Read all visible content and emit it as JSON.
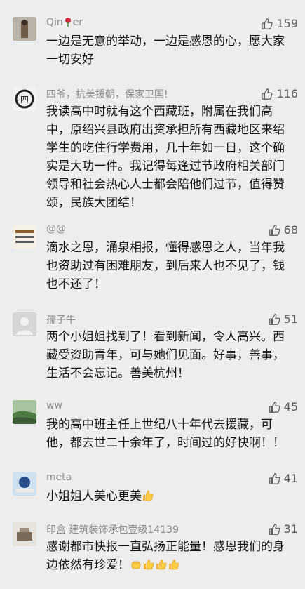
{
  "colors": {
    "background": "#ededed",
    "name": "#8a8a8a",
    "text": "#111111",
    "like": "#5a5a5a"
  },
  "comments": [
    {
      "name_a": "Qin",
      "name_b": "er",
      "name_emoji": "rose-icon",
      "likes": "159",
      "lines": [
        "一边是无意的举动，一边是感恩的心，愿大家",
        "一切安好"
      ]
    },
    {
      "name": "四爷，抗美援朝，保家卫国!",
      "likes": "116",
      "lines": [
        "我读高中时就有这个西藏班，附属在我们高",
        "中，原绍兴县政府出资承担所有西藏地区来绍",
        "学生的吃住行学费用，几十年如一日，这个确",
        "实是大功一件。我记得每逢过节政府相关部门",
        "领导和社会热心人士都会陪他们过节，值得赞",
        "颂，民族大团结！"
      ]
    },
    {
      "name": "@@",
      "likes": "68",
      "lines": [
        "滴水之恩，涌泉相报，懂得感恩之人，当年我",
        "也资助过有困难朋友，到后来人也不见了，钱",
        "也不还了！"
      ]
    },
    {
      "name": "孺子牛",
      "likes": "51",
      "lines": [
        "两个小姐姐找到了！看到新闻，令人高兴。西",
        "藏受资助青年，可与她们见面。好事，善事，",
        "生活不会忘记。善美杭州！"
      ]
    },
    {
      "name": "ww",
      "likes": "45",
      "lines": [
        "我的高中班主任上世纪八十年代去援藏，可",
        "他，都去世二十余年了，时间过的好快啊！！"
      ]
    },
    {
      "name": "meta",
      "likes": "41",
      "lines": [
        "小姐姐人美心更美"
      ]
    },
    {
      "name": "印盒 建筑装饰承包壹级14139",
      "likes": "31",
      "lines": [
        "感谢都市快报一直弘扬正能量！感恩我们的身",
        "边依然有珍爱！"
      ]
    }
  ]
}
